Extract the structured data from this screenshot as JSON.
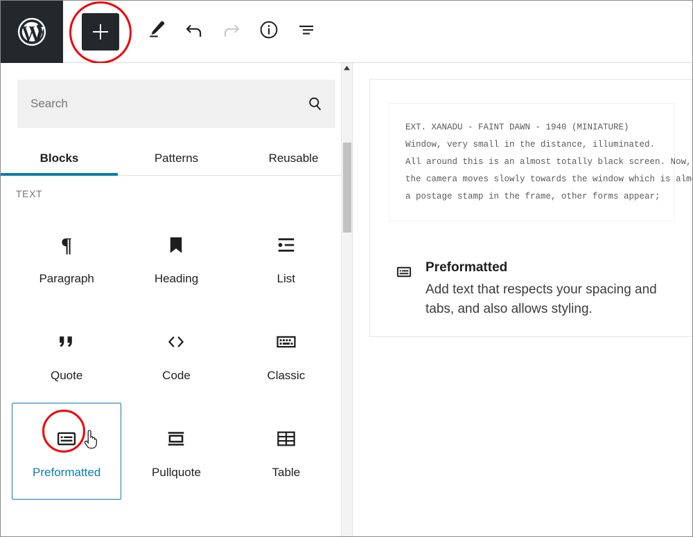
{
  "header": {
    "logo_icon": "wordpress-logo-icon",
    "inserter": {
      "label": "+",
      "icon": "plus-icon",
      "highlighted": true
    },
    "tools": [
      {
        "name": "edit-tools-button",
        "icon": "pencil-icon",
        "disabled": false
      },
      {
        "name": "undo-button",
        "icon": "undo-arrow-icon",
        "disabled": false
      },
      {
        "name": "redo-button",
        "icon": "redo-arrow-icon",
        "disabled": true
      },
      {
        "name": "details-button",
        "icon": "info-circle-icon",
        "disabled": false
      },
      {
        "name": "list-view-button",
        "icon": "list-view-icon",
        "disabled": false
      }
    ]
  },
  "inserter_panel": {
    "search": {
      "value": "",
      "placeholder": "Search",
      "icon": "search-icon"
    },
    "tabs": [
      {
        "label": "Blocks",
        "active": true
      },
      {
        "label": "Patterns",
        "active": false
      },
      {
        "label": "Reusable",
        "active": false
      }
    ],
    "category": "TEXT",
    "blocks": [
      {
        "label": "Paragraph",
        "icon": "paragraph-pilcrow-icon",
        "selected": false
      },
      {
        "label": "Heading",
        "icon": "heading-bookmark-icon",
        "selected": false
      },
      {
        "label": "List",
        "icon": "list-icon",
        "selected": false
      },
      {
        "label": "Quote",
        "icon": "quote-marks-icon",
        "selected": false
      },
      {
        "label": "Code",
        "icon": "code-angle-brackets-icon",
        "selected": false
      },
      {
        "label": "Classic",
        "icon": "classic-keyboard-icon",
        "selected": false
      },
      {
        "label": "Preformatted",
        "icon": "preformatted-icon",
        "selected": true
      },
      {
        "label": "Pullquote",
        "icon": "pullquote-icon",
        "selected": false
      },
      {
        "label": "Table",
        "icon": "table-grid-icon",
        "selected": false
      }
    ]
  },
  "preview": {
    "sample_text": "EXT. XANADU - FAINT DAWN - 1940 (MINIATURE)\nWindow, very small in the distance, illuminated.\nAll around this is an almost totally black screen. Now, as\nthe camera moves slowly towards the window which is almost\na postage stamp in the frame, other forms appear;",
    "info_icon": "preformatted-icon",
    "title": "Preformatted",
    "description": "Add text that respects your spacing and tabs, and also allows styling."
  },
  "colors": {
    "accent_blue": "#0b7dab",
    "highlight_red": "#f00000",
    "logo_bg": "#23282d",
    "search_bg": "#f0f0f0"
  }
}
